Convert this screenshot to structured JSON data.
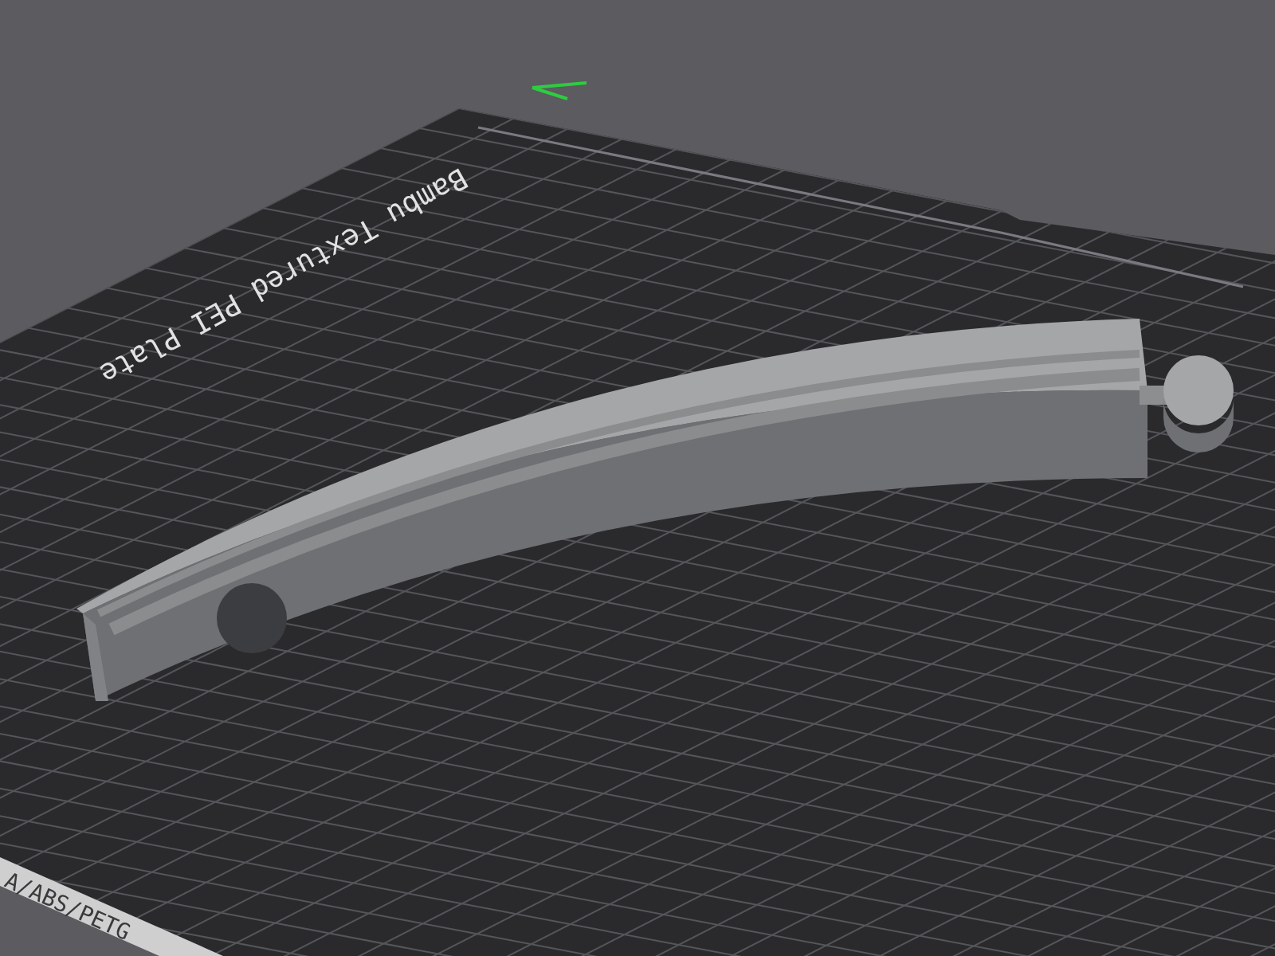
{
  "viewport": {
    "plate_label": "Bambu Textured PEI Plate",
    "plate_edge_label": "A/ABS/PETG"
  }
}
